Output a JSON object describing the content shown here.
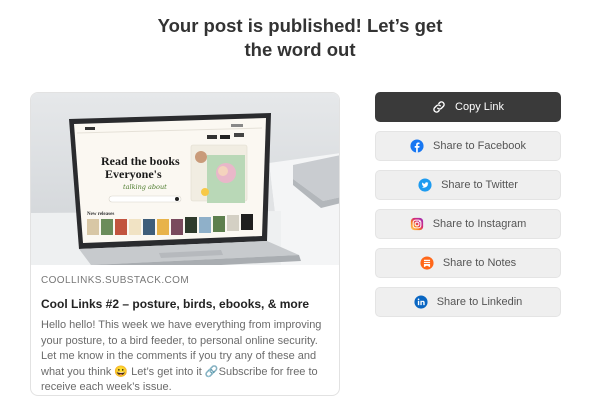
{
  "headline": {
    "line1": "Your post is published! Let’s get",
    "line2": "the word out"
  },
  "card": {
    "domain": "COOLLINKS.SUBSTACK.COM",
    "title": "Cool Links #2 – posture, birds, ebooks, & more",
    "excerpt": "Hello hello! This week we have everything from improving your posture, to a bird feeder, to personal online security. Let me know in the comments if you try any of these and what you think 😀 Let’s get into it 🔗Subscribe for free to receive each week’s issue.",
    "image": {
      "screen_heading_1": "Read the books",
      "screen_heading_2": "Everyone's",
      "screen_heading_script": "talking about",
      "screen_subheading": "New releases"
    }
  },
  "actions": [
    {
      "label": "Copy Link",
      "icon": "link-icon"
    },
    {
      "label": "Share to Facebook",
      "icon": "facebook-icon"
    },
    {
      "label": "Share to Twitter",
      "icon": "twitter-icon"
    },
    {
      "label": "Share to Instagram",
      "icon": "instagram-icon"
    },
    {
      "label": "Share to Notes",
      "icon": "notes-icon"
    },
    {
      "label": "Share to Linkedin",
      "icon": "linkedin-icon"
    }
  ],
  "colors": {
    "primary_button": "#3a3a3a",
    "facebook": "#1877f2",
    "twitter": "#1d9bf0",
    "notes": "#ff6719",
    "linkedin": "#0a66c2"
  }
}
